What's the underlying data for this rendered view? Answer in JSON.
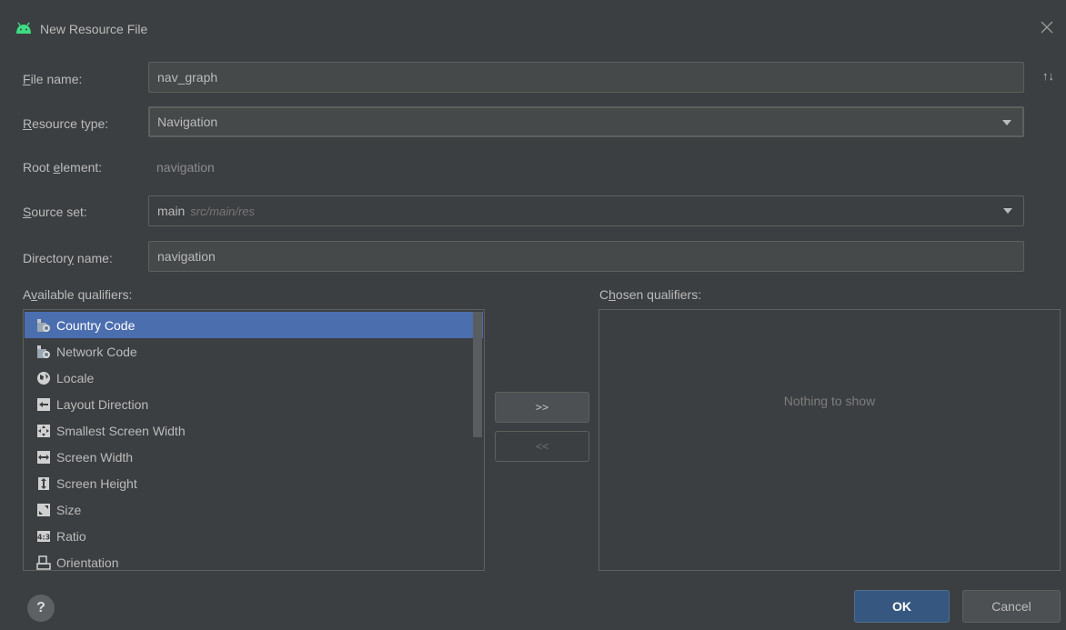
{
  "window": {
    "title": "New Resource File",
    "icon": "android-icon",
    "close_icon": "close-icon"
  },
  "form": {
    "file_name": {
      "label_pre": "",
      "label_key": "F",
      "label_post": "ile name:",
      "value": "nav_graph"
    },
    "resource_type": {
      "label_pre": "",
      "label_key": "R",
      "label_post": "esource type:",
      "value": "Navigation"
    },
    "root_element": {
      "label_pre": "Root ",
      "label_key": "e",
      "label_post": "lement:",
      "value": "navigation"
    },
    "source_set": {
      "label_pre": "",
      "label_key": "S",
      "label_post": "ource set:",
      "value_main": "main",
      "value_path": "src/main/res"
    },
    "directory_name": {
      "label_pre": "Director",
      "label_key": "y",
      "label_post": " name:",
      "value": "navigation"
    },
    "sort_icon": "sort-arrows-icon"
  },
  "qualifiers": {
    "available_label_pre": "A",
    "available_label_key": "v",
    "available_label_post": "ailable qualifiers:",
    "chosen_label_pre": "C",
    "chosen_label_key": "h",
    "chosen_label_post": "osen qualifiers:",
    "available": [
      {
        "label": "Country Code",
        "icon": "country-code-icon",
        "selected": true
      },
      {
        "label": "Network Code",
        "icon": "network-code-icon",
        "selected": false
      },
      {
        "label": "Locale",
        "icon": "globe-icon",
        "selected": false
      },
      {
        "label": "Layout Direction",
        "icon": "layout-direction-icon",
        "selected": false
      },
      {
        "label": "Smallest Screen Width",
        "icon": "smallest-width-icon",
        "selected": false
      },
      {
        "label": "Screen Width",
        "icon": "screen-width-icon",
        "selected": false
      },
      {
        "label": "Screen Height",
        "icon": "screen-height-icon",
        "selected": false
      },
      {
        "label": "Size",
        "icon": "size-icon",
        "selected": false
      },
      {
        "label": "Ratio",
        "icon": "ratio-icon",
        "selected": false
      },
      {
        "label": "Orientation",
        "icon": "orientation-icon",
        "selected": false
      }
    ],
    "chosen_empty": "Nothing to show",
    "add_button": ">>",
    "remove_button": "<<"
  },
  "footer": {
    "help": "?",
    "ok": "OK",
    "cancel": "Cancel"
  },
  "colors": {
    "background": "#3c3f41",
    "selection": "#4b6eaf",
    "focus_border": "#466d94",
    "ok_button": "#365880"
  }
}
